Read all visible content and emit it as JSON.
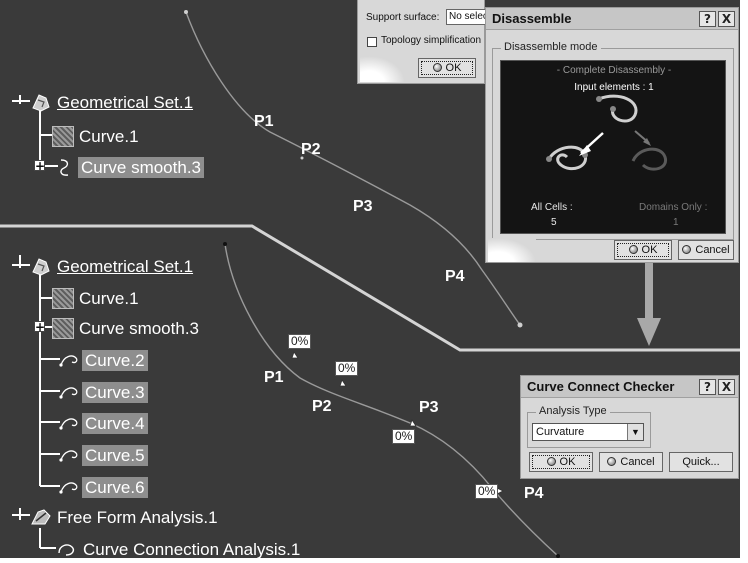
{
  "colors": {
    "viewport_bg": "#3a3a3a",
    "dialog_bg": "#d8d8d8",
    "highlight": "#8e8e8e",
    "arrow": "#a8a8a8"
  },
  "top_tree": {
    "root": {
      "label": "Geometrical Set.1",
      "icon": "geometrical-set-icon"
    },
    "items": [
      {
        "label": "Curve.1",
        "icon": "curve-icon",
        "highlighted": false
      },
      {
        "label": "Curve smooth.3",
        "icon": "curve-smooth-icon",
        "highlighted": true
      }
    ]
  },
  "bottom_tree": {
    "root": {
      "label": "Geometrical Set.1",
      "icon": "geometrical-set-icon"
    },
    "items": [
      {
        "label": "Curve.1",
        "icon": "curve-icon",
        "highlighted": false
      },
      {
        "label": "Curve smooth.3",
        "icon": "curve-smooth-icon",
        "highlighted": false
      },
      {
        "label": "Curve.2",
        "icon": "curve-icon",
        "highlighted": true
      },
      {
        "label": "Curve.3",
        "icon": "curve-icon",
        "highlighted": true
      },
      {
        "label": "Curve.4",
        "icon": "curve-icon",
        "highlighted": true
      },
      {
        "label": "Curve.5",
        "icon": "curve-icon",
        "highlighted": true
      },
      {
        "label": "Curve.6",
        "icon": "curve-icon",
        "highlighted": true
      }
    ],
    "analysis": {
      "label": "Free Form Analysis.1",
      "icon": "free-form-analysis-icon"
    },
    "analysis_child": {
      "label": "Curve Connection Analysis.1",
      "icon": "curve-connection-icon"
    }
  },
  "top_points": [
    "P1",
    "P2",
    "P3",
    "P4"
  ],
  "bottom_points": [
    "P1",
    "P2",
    "P3",
    "P4"
  ],
  "connection_percentages": [
    "0%",
    "0%",
    "0%",
    "0%"
  ],
  "smooth_dialog": {
    "support_surface_label": "Support surface:",
    "support_surface_value": "No selec",
    "topology_label": "Topology simplification",
    "topology_checked": false,
    "ok_label": "OK"
  },
  "disassemble_dialog": {
    "title": "Disassemble",
    "help": "?",
    "close": "X",
    "mode_group": "Disassemble mode",
    "complete_label": "- Complete Disassembly -",
    "input_elements_label": "Input elements : 1",
    "all_cells_label": "All Cells :",
    "all_cells_value": "5",
    "domains_only_label": "Domains Only :",
    "domains_only_value": "1",
    "ok_label": "OK",
    "cancel_label": "Cancel"
  },
  "checker_dialog": {
    "title": "Curve Connect Checker",
    "help": "?",
    "close": "X",
    "analysis_type_label": "Analysis Type",
    "analysis_type_value": "Curvature",
    "ok_label": "OK",
    "cancel_label": "Cancel",
    "quick_label": "Quick..."
  }
}
